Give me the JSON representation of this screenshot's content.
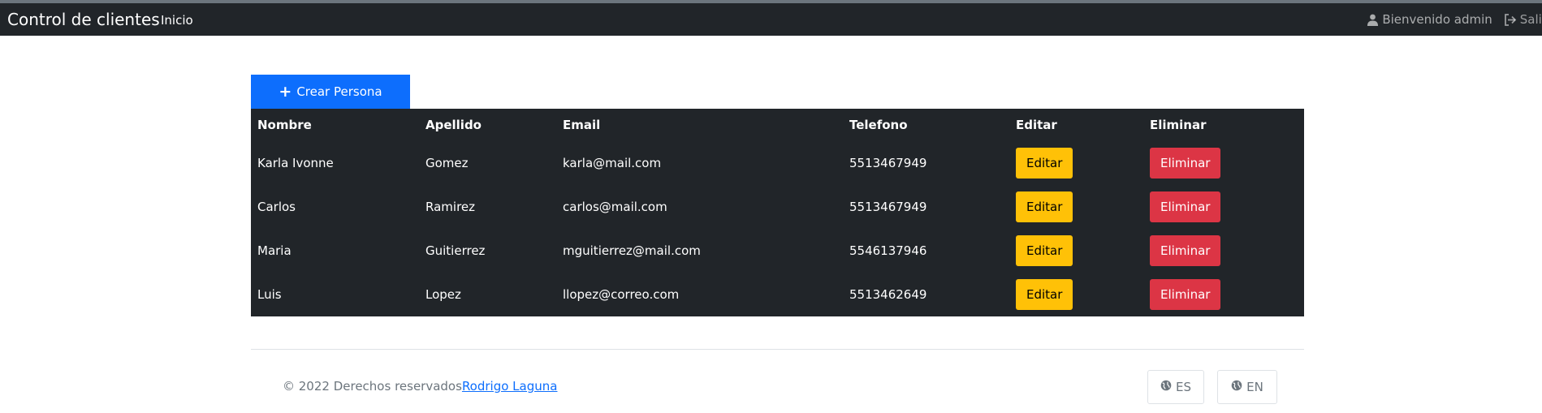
{
  "navbar": {
    "brand": "Control de clientes",
    "home_link": "Inicio",
    "welcome_text": "Bienvenido admin",
    "logout_text": "Salir",
    "icons": {
      "user": "user-icon",
      "logout": "logout-icon"
    }
  },
  "actions": {
    "create_label": "Crear Persona",
    "create_icon": "plus-icon"
  },
  "table": {
    "headers": [
      "Nombre",
      "Apellido",
      "Email",
      "Telefono",
      "Editar",
      "Eliminar"
    ],
    "rows": [
      {
        "nombre": "Karla Ivonne",
        "apellido": "Gomez",
        "email": "karla@mail.com",
        "telefono": "5513467949",
        "edit_label": "Editar",
        "delete_label": "Eliminar"
      },
      {
        "nombre": "Carlos",
        "apellido": "Ramirez",
        "email": "carlos@mail.com",
        "telefono": "5513467949",
        "edit_label": "Editar",
        "delete_label": "Eliminar"
      },
      {
        "nombre": "Maria",
        "apellido": "Guitierrez",
        "email": "mguitierrez@mail.com",
        "telefono": "5546137946",
        "edit_label": "Editar",
        "delete_label": "Eliminar"
      },
      {
        "nombre": "Luis",
        "apellido": "Lopez",
        "email": "llopez@correo.com",
        "telefono": "5513462649",
        "edit_label": "Editar",
        "delete_label": "Eliminar"
      }
    ]
  },
  "footer": {
    "copyright": "© 2022 Derechos reservados",
    "author_link": "Rodrigo Laguna",
    "languages": [
      {
        "label": "ES",
        "icon": "globe-icon"
      },
      {
        "label": "EN",
        "icon": "globe-icon"
      }
    ]
  },
  "colors": {
    "navbar_bg": "#212529",
    "primary": "#0d6efd",
    "warning": "#ffc107",
    "danger": "#dc3545",
    "table_bg": "#212529"
  }
}
